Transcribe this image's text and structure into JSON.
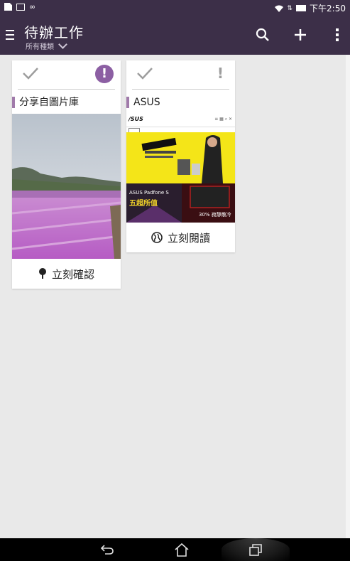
{
  "status_bar": {
    "time": "下午2:50",
    "icons": [
      "document-icon",
      "image-icon",
      "infinity-icon",
      "wifi-icon",
      "battery-icon"
    ]
  },
  "action_bar": {
    "title": "待辦工作",
    "filter_label": "所有種類",
    "actions": [
      "search-icon",
      "add-icon",
      "overflow-menu-icon"
    ]
  },
  "tasks": [
    {
      "title": "分享自圖片庫",
      "priority": "high",
      "action_label": "立刻確認",
      "action_icon": "pin-icon"
    },
    {
      "title": "ASUS",
      "priority": "normal",
      "action_label": "立刻閱讀",
      "action_icon": "globe-icon",
      "preview": {
        "logo": "/SUS",
        "banner_text_1": "ASUS Padfone S",
        "banner_text_2": "五超所值",
        "banner_text_3": "30% 寂靜散冷"
      }
    }
  ],
  "nav_bar": {
    "buttons": [
      "back-icon",
      "home-icon",
      "recent-apps-icon"
    ]
  },
  "colors": {
    "primary": "#3c2f48",
    "accent": "#8c5fa3",
    "label_marker": "#a07aaa",
    "background": "#e9e9e9"
  }
}
